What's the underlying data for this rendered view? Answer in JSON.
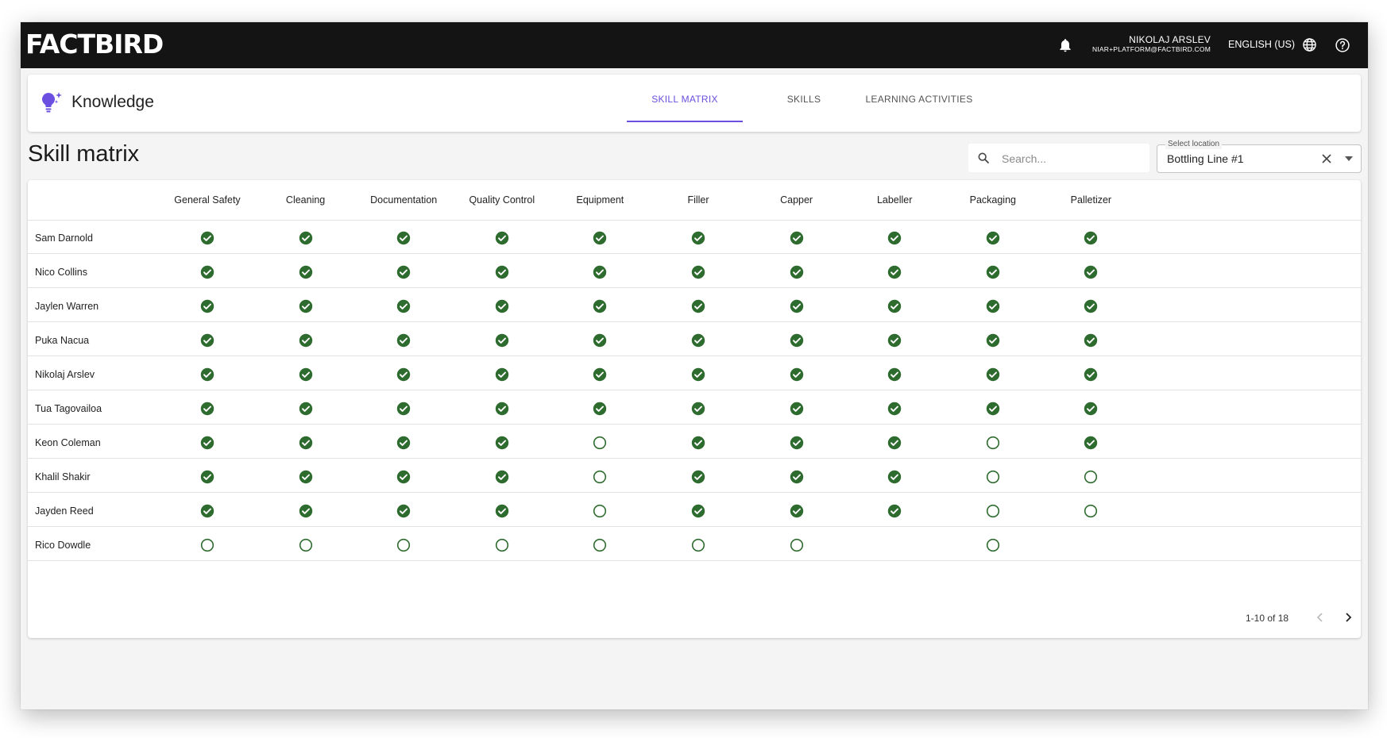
{
  "header": {
    "logo_text": "FACTBIRD",
    "user_name": "NIKOLAJ ARSLEV",
    "user_email": "NIAR+PLATFORM@FACTBIRD.COM",
    "language": "ENGLISH (US)"
  },
  "module": {
    "title": "Knowledge",
    "tabs": [
      {
        "label": "SKILL MATRIX",
        "active": true
      },
      {
        "label": "SKILLS",
        "active": false
      },
      {
        "label": "LEARNING ACTIVITIES",
        "active": false
      }
    ]
  },
  "page": {
    "title": "Skill matrix",
    "search_placeholder": "Search...",
    "location_label": "Select location",
    "location_value": "Bottling Line #1"
  },
  "table": {
    "columns": [
      "General Safety",
      "Cleaning",
      "Documentation",
      "Quality Control",
      "Equipment",
      "Filler",
      "Capper",
      "Labeller",
      "Packaging",
      "Palletizer"
    ],
    "rows": [
      {
        "name": "Sam Darnold",
        "skills": [
          "done",
          "done",
          "done",
          "done",
          "done",
          "done",
          "done",
          "done",
          "done",
          "done"
        ]
      },
      {
        "name": "Nico Collins",
        "skills": [
          "done",
          "done",
          "done",
          "done",
          "done",
          "done",
          "done",
          "done",
          "done",
          "done"
        ]
      },
      {
        "name": "Jaylen Warren",
        "skills": [
          "done",
          "done",
          "done",
          "done",
          "done",
          "done",
          "done",
          "done",
          "done",
          "done"
        ]
      },
      {
        "name": "Puka Nacua",
        "skills": [
          "done",
          "done",
          "done",
          "done",
          "done",
          "done",
          "done",
          "done",
          "done",
          "done"
        ]
      },
      {
        "name": "Nikolaj Arslev",
        "skills": [
          "done",
          "done",
          "done",
          "done",
          "done",
          "done",
          "done",
          "done",
          "done",
          "done"
        ]
      },
      {
        "name": "Tua Tagovailoa",
        "skills": [
          "done",
          "done",
          "done",
          "done",
          "done",
          "done",
          "done",
          "done",
          "done",
          "done"
        ]
      },
      {
        "name": "Keon Coleman",
        "skills": [
          "done",
          "done",
          "done",
          "done",
          "pending",
          "done",
          "done",
          "done",
          "pending",
          "done"
        ]
      },
      {
        "name": "Khalil Shakir",
        "skills": [
          "done",
          "done",
          "done",
          "done",
          "pending",
          "done",
          "done",
          "done",
          "pending",
          "pending"
        ]
      },
      {
        "name": "Jayden Reed",
        "skills": [
          "done",
          "done",
          "done",
          "done",
          "pending",
          "done",
          "done",
          "done",
          "pending",
          "pending"
        ]
      },
      {
        "name": "Rico Dowdle",
        "skills": [
          "pending",
          "pending",
          "pending",
          "pending",
          "pending",
          "pending",
          "pending",
          "none",
          "pending",
          "none"
        ]
      }
    ],
    "pagination": "1-10 of 18"
  },
  "colors": {
    "accent": "#6b4fe0",
    "check": "#2e6b2e",
    "topbar": "#141414"
  }
}
